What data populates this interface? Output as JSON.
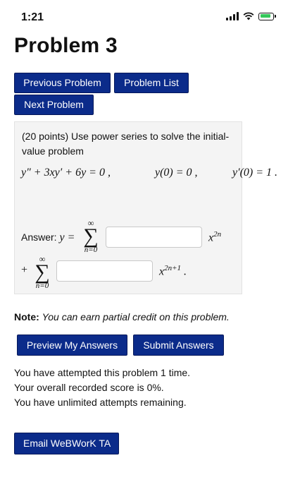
{
  "status_bar": {
    "time": "1:21"
  },
  "page": {
    "title": "Problem 3"
  },
  "nav": {
    "previous": "Previous Problem",
    "list": "Problem List",
    "next": "Next Problem"
  },
  "problem": {
    "statement": "(20 points) Use power series to solve the initial-value problem",
    "equation": "y″ + 3xy′ + 6y = 0 ,",
    "initial1": "y(0) = 0 ,",
    "initial2": "y′(0) = 1 .",
    "answer_label": "Answer:",
    "answer_lhs": "y =",
    "sum_upper": "∞",
    "sum_symbol": "∑",
    "sum_lower": "n=0",
    "plus": "+",
    "term1_base": "x",
    "term1_exp": "2n",
    "term2_base": "x",
    "term2_exp": "2n+1",
    "term2_end": "."
  },
  "note": {
    "label": "Note:",
    "text": "You can earn partial credit on this problem."
  },
  "actions": {
    "preview": "Preview My Answers",
    "submit": "Submit Answers",
    "email": "Email WeBWorK TA"
  },
  "attempts": {
    "line1": "You have attempted this problem 1 time.",
    "line2": "Your overall recorded score is 0%.",
    "line3": "You have unlimited attempts remaining."
  },
  "colors": {
    "button_bg": "#0b2b8a",
    "box_bg": "#f4f4f4",
    "battery": "#34c759"
  }
}
